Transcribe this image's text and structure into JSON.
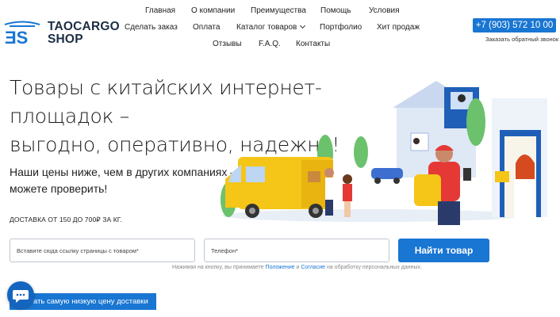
{
  "brand": {
    "line1": "TAOCARGO",
    "line2": "SHOP"
  },
  "nav": {
    "row1": [
      "Главная",
      "О компании",
      "Преимущества",
      "Помощь",
      "Условия"
    ],
    "row2": [
      "Сделать заказ",
      "Оплата",
      "Каталог товаров",
      "Портфолио",
      "Хит продаж"
    ],
    "row3": [
      "Отзывы",
      "F.A.Q.",
      "Контакты"
    ]
  },
  "contact": {
    "phone": "+7 (903) 572 10 00",
    "callback": "Заказать обратный звонок"
  },
  "hero": {
    "title_line1": "Товары с китайских интернет-площадок –",
    "title_line2": "выгодно, оперативно, надежно!",
    "subtitle_line1": "Наши цены ниже, чем в других компаниях —",
    "subtitle_line2": "можете проверить!",
    "delivery": "ДОСТАВКА ОТ 150 ДО 700₽ ЗА КГ."
  },
  "form": {
    "link_placeholder": "Вставите сюда ссылку страницы с товаром*",
    "phone_placeholder": "Телефон*",
    "submit_label": "Найти товар",
    "consent_prefix": "Нажимая на кнопку, вы принимаете",
    "consent_link1": "Положение",
    "consent_and": "и",
    "consent_link2": "Согласие",
    "consent_suffix": "на обработку персональных данных."
  },
  "cta": {
    "low_price_label": "ать самую низкую цену доставки"
  },
  "colors": {
    "accent": "#1976d2",
    "van": "#f5c518",
    "courier": "#e53935"
  },
  "icons": {
    "chat": "chat-bubble-icon",
    "menu_chevron": "chevron-down-icon"
  }
}
